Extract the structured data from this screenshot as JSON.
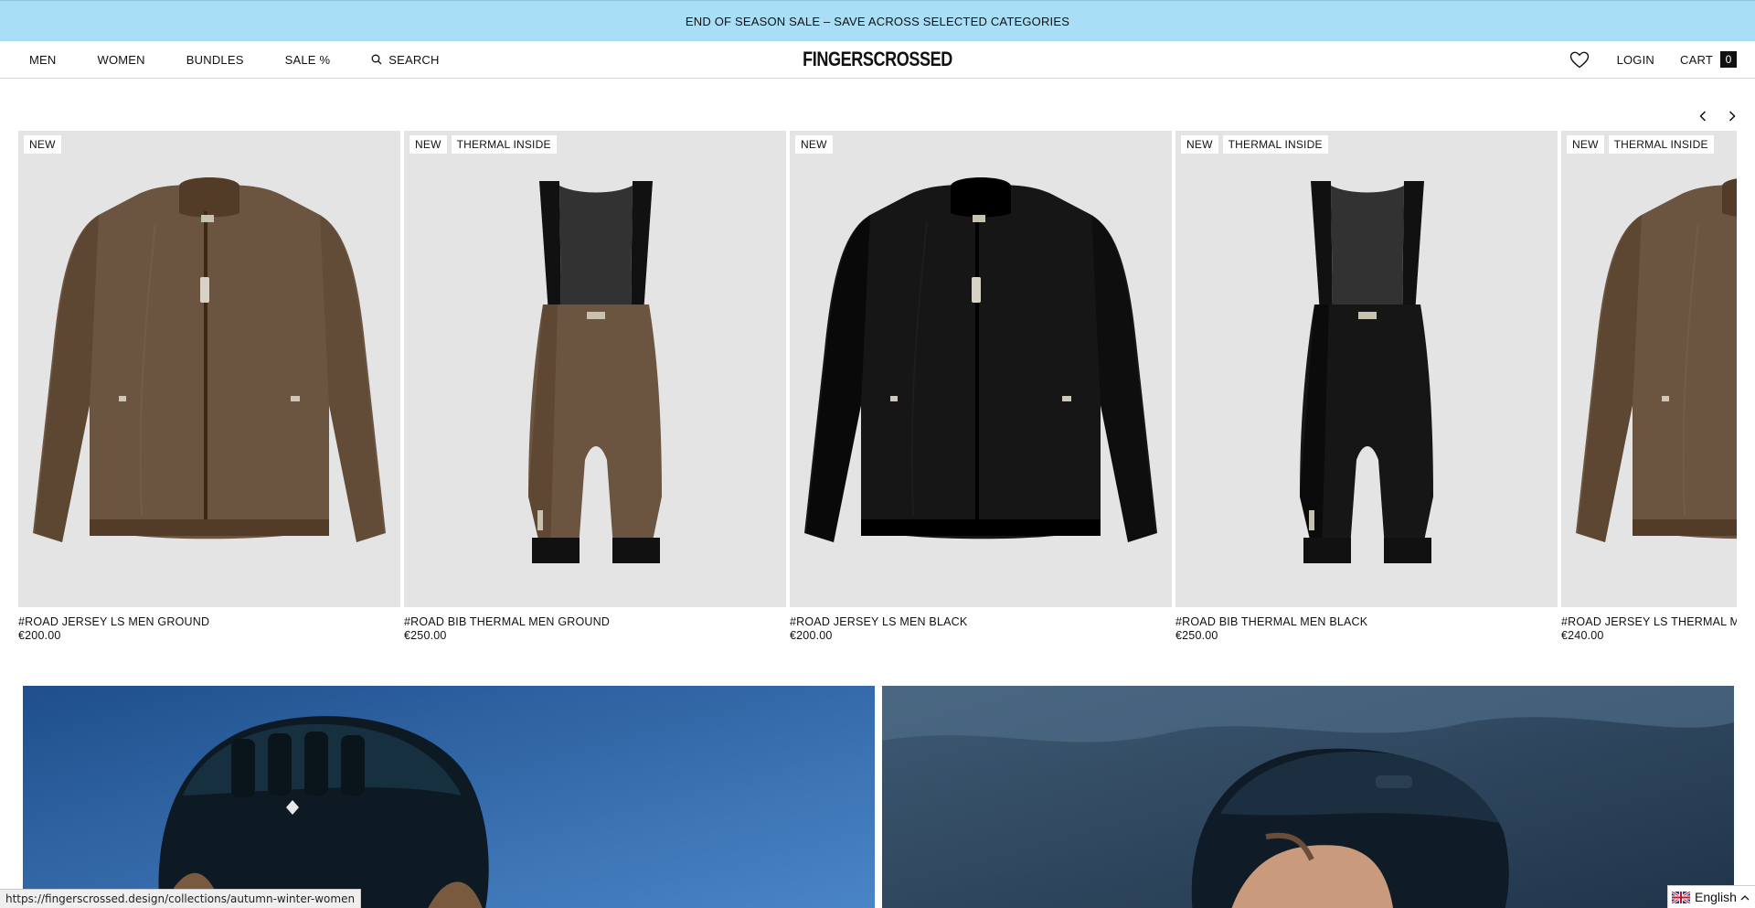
{
  "announcement": {
    "text": "END OF SEASON SALE – SAVE ACROSS SELECTED CATEGORIES"
  },
  "nav": {
    "links": [
      {
        "label": "MEN"
      },
      {
        "label": "WOMEN"
      },
      {
        "label": "BUNDLES"
      },
      {
        "label": "SALE %"
      }
    ],
    "search_label": "SEARCH",
    "logo": "FINGERSCROSSED",
    "login_label": "LOGIN",
    "cart_label": "CART",
    "cart_count": "0",
    "icons": {
      "search": "search-icon",
      "wishlist": "heart-icon"
    }
  },
  "carousel": {
    "icons": {
      "prev": "chevron-left-icon",
      "next": "chevron-right-icon"
    },
    "products": [
      {
        "name": "#ROAD JERSEY LS MEN GROUND",
        "price": "€200.00",
        "badges": [
          "NEW"
        ],
        "product_color": "#6b5440",
        "type": "jersey"
      },
      {
        "name": "#ROAD BIB THERMAL MEN GROUND",
        "price": "€250.00",
        "badges": [
          "NEW",
          "THERMAL INSIDE"
        ],
        "product_color": "#6b5440",
        "type": "bib"
      },
      {
        "name": "#ROAD JERSEY LS MEN BLACK",
        "price": "€200.00",
        "badges": [
          "NEW"
        ],
        "product_color": "#161616",
        "type": "jersey"
      },
      {
        "name": "#ROAD BIB THERMAL MEN BLACK",
        "price": "€250.00",
        "badges": [
          "NEW",
          "THERMAL INSIDE"
        ],
        "product_color": "#161616",
        "type": "bib"
      },
      {
        "name": "#ROAD JERSEY LS THERMAL ME",
        "price": "€240.00",
        "badges": [
          "NEW",
          "THERMAL INSIDE"
        ],
        "product_color": "#6b5440",
        "type": "jersey"
      }
    ]
  },
  "banners": [
    {
      "image": "cyclist-helmet-sky-photo"
    },
    {
      "image": "cyclist-woman-helmet-photo"
    }
  ],
  "status_bar": {
    "url": "https://fingerscrossed.design/collections/autumn-winter-women"
  },
  "language": {
    "label": "English",
    "icon": "uk-flag-icon"
  },
  "colors": {
    "announcement_bg": "#a8def6",
    "product_bg": "#e4e4e4"
  }
}
